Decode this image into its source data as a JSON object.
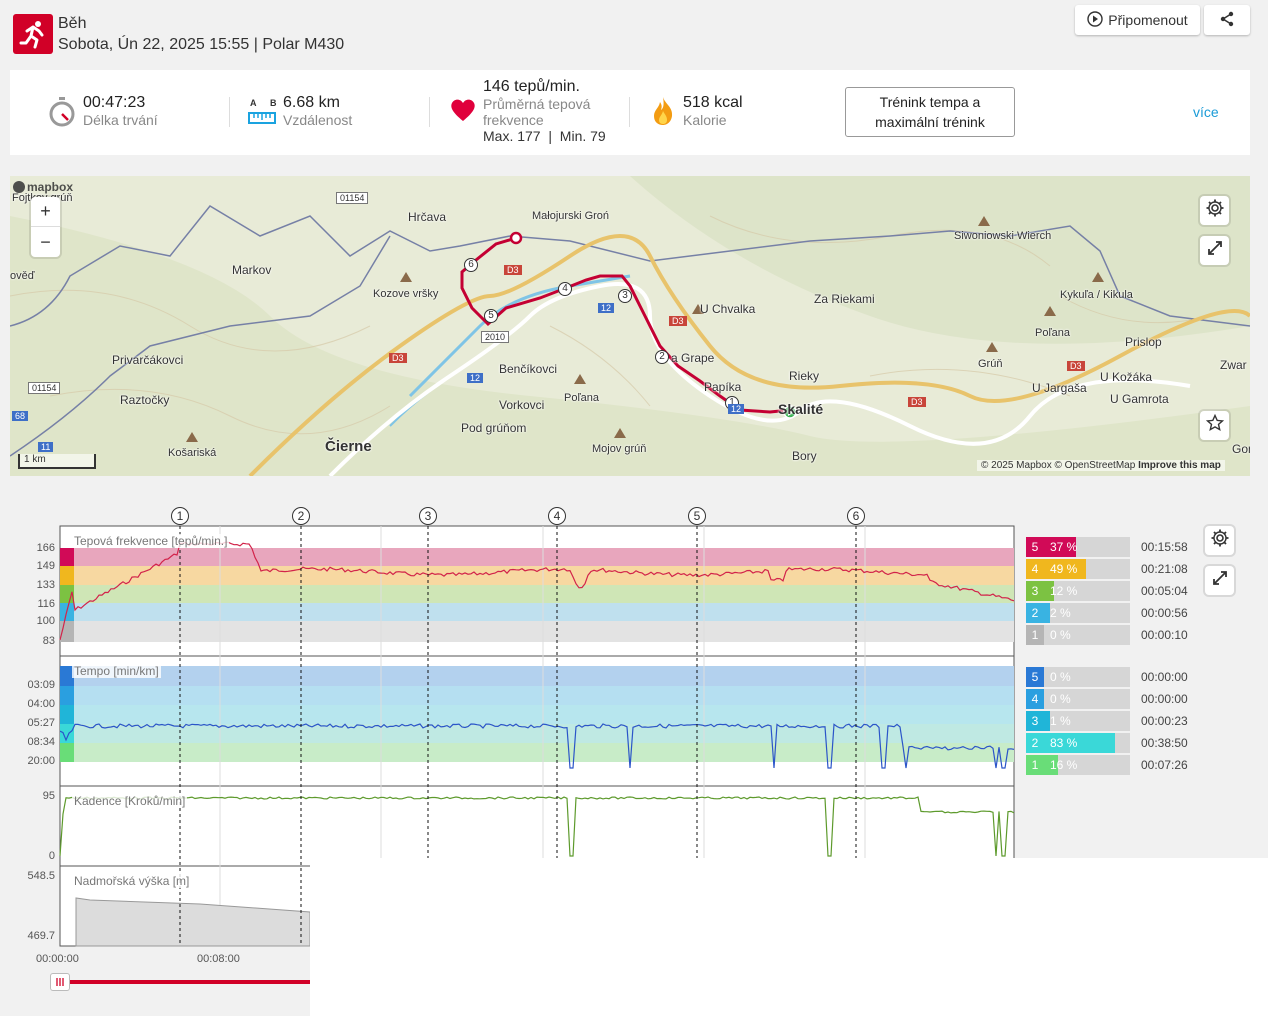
{
  "header": {
    "title": "Běh",
    "date": "Sobota, Ún 22, 2025 15:55",
    "separator": "|",
    "device": "Polar M430",
    "remind_label": "Připomenout",
    "share_icon": "share-icon",
    "sport_icon": "running-icon",
    "brand_color": "#d10027"
  },
  "summary": {
    "duration": {
      "value": "00:47:23",
      "label": "Délka trvání"
    },
    "distance": {
      "value": "6.68 km",
      "label": "Vzdálenost",
      "icon_a": "A",
      "icon_b": "B"
    },
    "heart": {
      "value": "146 tepů/min.",
      "label1": "Průměrná tepová",
      "label2": "frekvence",
      "max_label": "Max. 177",
      "sep": "|",
      "min_label": "Min. 79"
    },
    "calories": {
      "value": "518 kcal",
      "label": "Kalorie"
    },
    "training_button": "Trénink tempa a maximální trénink",
    "more_link": "více"
  },
  "map": {
    "logo": "mapbox",
    "zoom_in": "+",
    "zoom_out": "−",
    "scale": "1 km",
    "attribution": "© 2025 Mapbox © OpenStreetMap",
    "improve": "Improve this map",
    "places": [
      "Fojtkov grúň",
      "Hrčava",
      "Małojurski Groń",
      "Markov",
      "Kozove vršky",
      "Siwoniowski Wierch",
      "U Chvalka",
      "Za Riekami",
      "Kykuľa / Kikula",
      "Poľana",
      "Prislop",
      "Privarčákovci",
      "Benčíkovci",
      "a Grape",
      "Rieky",
      "Grúň",
      "U Jargaša",
      "U Kožáka",
      "Zwar",
      "Raztočky",
      "Papíka",
      "Skalité",
      "U Gamrota",
      "Vorkovci",
      "Pod grúňom",
      "Mojov grúň",
      "Košariská",
      "Čierne",
      "Bory",
      "Gomu",
      "Poľana",
      "ověď"
    ],
    "roads": [
      "01154",
      "D3",
      "D3",
      "12",
      "2010",
      "12",
      "D3",
      "D3",
      "D3",
      "01154",
      "68",
      "11",
      "12"
    ],
    "laps": [
      "1",
      "2",
      "3",
      "4",
      "5",
      "6"
    ]
  },
  "chart": {
    "lap_markers": [
      "1",
      "2",
      "3",
      "4",
      "5",
      "6"
    ],
    "hr_label": "Tepová frekvence [tepů/min.]",
    "hr_ticks": [
      "166",
      "149",
      "133",
      "116",
      "100",
      "83"
    ],
    "pace_label": "Tempo [min/km]",
    "pace_ticks": [
      "03:09",
      "04:00",
      "05:27",
      "08:34",
      "20:00"
    ],
    "cad_label": "Kadence [Kroků/min]",
    "cad_ticks": [
      "95",
      "0"
    ],
    "alt_label": "Nadmořská výška [m]",
    "alt_ticks": [
      "548.5",
      "469.7"
    ],
    "time_ticks": [
      "00:00:00",
      "00:08:00"
    ],
    "hr_zones": [
      {
        "zone": "5",
        "pct": "37 %",
        "time": "00:15:58",
        "fraction": 0.37,
        "color": "#d10a57"
      },
      {
        "zone": "4",
        "pct": "49 %",
        "time": "00:21:08",
        "fraction": 0.49,
        "color": "#f0b71e"
      },
      {
        "zone": "3",
        "pct": "12 %",
        "time": "00:05:04",
        "fraction": 0.12,
        "color": "#7cc242"
      },
      {
        "zone": "2",
        "pct": "2 %",
        "time": "00:00:56",
        "fraction": 0.02,
        "color": "#39b3e2"
      },
      {
        "zone": "1",
        "pct": "0 %",
        "time": "00:00:10",
        "fraction": 0.0,
        "color": "#b5b5b5"
      }
    ],
    "pace_zones": [
      {
        "zone": "5",
        "pct": "0 %",
        "time": "00:00:00",
        "fraction": 0.0,
        "color": "#2a79d5"
      },
      {
        "zone": "4",
        "pct": "0 %",
        "time": "00:00:00",
        "fraction": 0.0,
        "color": "#2a9fe0"
      },
      {
        "zone": "3",
        "pct": "1 %",
        "time": "00:00:23",
        "fraction": 0.01,
        "color": "#20b5d8"
      },
      {
        "zone": "2",
        "pct": "83 %",
        "time": "00:38:50",
        "fraction": 0.83,
        "color": "#3ad8d8"
      },
      {
        "zone": "1",
        "pct": "16 %",
        "time": "00:07:26",
        "fraction": 0.16,
        "color": "#69dd78"
      }
    ]
  }
}
